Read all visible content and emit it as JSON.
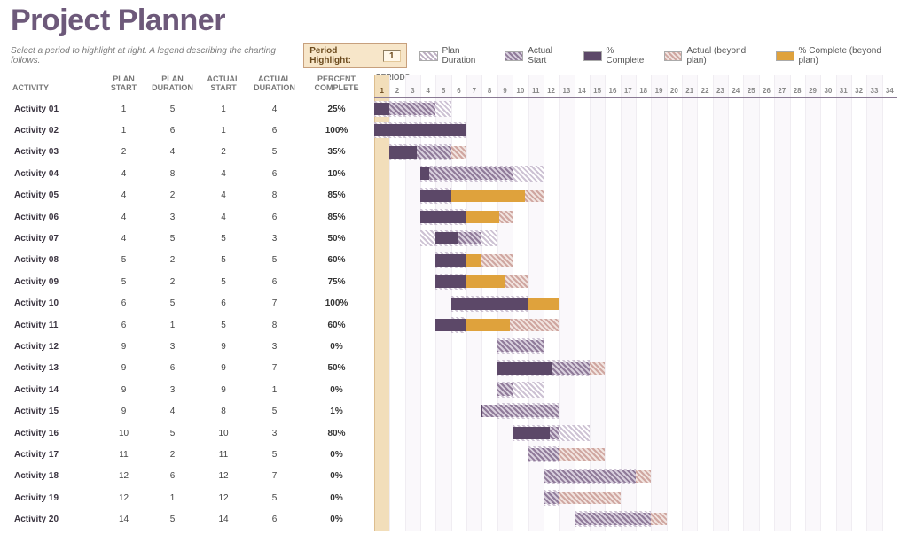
{
  "title": "Project Planner",
  "hint": "Select a period to highlight at right. A legend describing the charting follows.",
  "period_highlight_label": "Period Highlight:",
  "period_highlight_value": 1,
  "legend": {
    "plan": "Plan Duration",
    "actual": "Actual Start",
    "complete": "% Complete",
    "beyond": "Actual (beyond plan)",
    "beyond_complete": "% Complete (beyond plan)"
  },
  "columns": {
    "activity": "Activity",
    "plan_start": "Plan Start",
    "plan_dur": "Plan Duration",
    "actual_start": "Actual Start",
    "actual_dur": "Actual Duration",
    "pct": "Percent Complete",
    "periods": "Periods"
  },
  "periods": 34,
  "chart_data": {
    "type": "gantt",
    "x_axis": "Periods 1–34",
    "rows": [
      {
        "name": "Activity 01",
        "plan_start": 1,
        "plan_dur": 5,
        "actual_start": 1,
        "actual_dur": 4,
        "pct": 25
      },
      {
        "name": "Activity 02",
        "plan_start": 1,
        "plan_dur": 6,
        "actual_start": 1,
        "actual_dur": 6,
        "pct": 100
      },
      {
        "name": "Activity 03",
        "plan_start": 2,
        "plan_dur": 4,
        "actual_start": 2,
        "actual_dur": 5,
        "pct": 35
      },
      {
        "name": "Activity 04",
        "plan_start": 4,
        "plan_dur": 8,
        "actual_start": 4,
        "actual_dur": 6,
        "pct": 10
      },
      {
        "name": "Activity 05",
        "plan_start": 4,
        "plan_dur": 2,
        "actual_start": 4,
        "actual_dur": 8,
        "pct": 85
      },
      {
        "name": "Activity 06",
        "plan_start": 4,
        "plan_dur": 3,
        "actual_start": 4,
        "actual_dur": 6,
        "pct": 85
      },
      {
        "name": "Activity 07",
        "plan_start": 4,
        "plan_dur": 5,
        "actual_start": 5,
        "actual_dur": 3,
        "pct": 50
      },
      {
        "name": "Activity 08",
        "plan_start": 5,
        "plan_dur": 2,
        "actual_start": 5,
        "actual_dur": 5,
        "pct": 60
      },
      {
        "name": "Activity 09",
        "plan_start": 5,
        "plan_dur": 2,
        "actual_start": 5,
        "actual_dur": 6,
        "pct": 75
      },
      {
        "name": "Activity 10",
        "plan_start": 6,
        "plan_dur": 5,
        "actual_start": 6,
        "actual_dur": 7,
        "pct": 100
      },
      {
        "name": "Activity 11",
        "plan_start": 6,
        "plan_dur": 1,
        "actual_start": 5,
        "actual_dur": 8,
        "pct": 60
      },
      {
        "name": "Activity 12",
        "plan_start": 9,
        "plan_dur": 3,
        "actual_start": 9,
        "actual_dur": 3,
        "pct": 0
      },
      {
        "name": "Activity 13",
        "plan_start": 9,
        "plan_dur": 6,
        "actual_start": 9,
        "actual_dur": 7,
        "pct": 50
      },
      {
        "name": "Activity 14",
        "plan_start": 9,
        "plan_dur": 3,
        "actual_start": 9,
        "actual_dur": 1,
        "pct": 0
      },
      {
        "name": "Activity 15",
        "plan_start": 9,
        "plan_dur": 4,
        "actual_start": 8,
        "actual_dur": 5,
        "pct": 1
      },
      {
        "name": "Activity 16",
        "plan_start": 10,
        "plan_dur": 5,
        "actual_start": 10,
        "actual_dur": 3,
        "pct": 80
      },
      {
        "name": "Activity 17",
        "plan_start": 11,
        "plan_dur": 2,
        "actual_start": 11,
        "actual_dur": 5,
        "pct": 0
      },
      {
        "name": "Activity 18",
        "plan_start": 12,
        "plan_dur": 6,
        "actual_start": 12,
        "actual_dur": 7,
        "pct": 0
      },
      {
        "name": "Activity 19",
        "plan_start": 12,
        "plan_dur": 1,
        "actual_start": 12,
        "actual_dur": 5,
        "pct": 0
      },
      {
        "name": "Activity 20",
        "plan_start": 14,
        "plan_dur": 5,
        "actual_start": 14,
        "actual_dur": 6,
        "pct": 0
      }
    ]
  }
}
